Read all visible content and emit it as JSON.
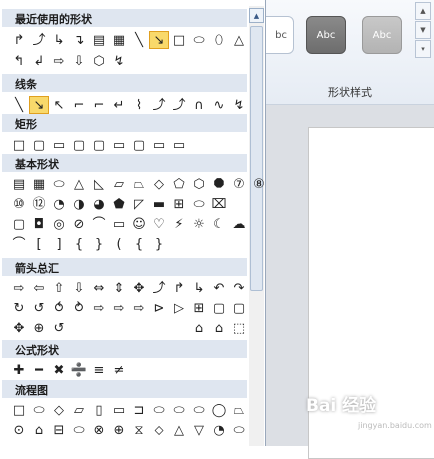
{
  "ribbon": {
    "style_samples": [
      "bc",
      "Abc",
      "Abc"
    ],
    "group_label": "形状样式"
  },
  "watermark": {
    "text": "Bai 经验",
    "sub": "jingyan.baidu.com"
  },
  "panel": {
    "categories": [
      {
        "label": "最近使用的形状",
        "rows": [
          [
            "↱",
            "⤴",
            "↳",
            "↴",
            "▤",
            "▦",
            "╲",
            "↘",
            "□",
            "⬭",
            "⬯",
            "△"
          ],
          [
            "↰",
            "↲",
            "⇨",
            "⇩",
            "⬡",
            "↯"
          ]
        ]
      },
      {
        "label": "线条",
        "rows": [
          [
            "╲",
            "↘",
            "↖",
            "⌐",
            "⌐",
            "↵",
            "⌇",
            "⤴",
            "⤴",
            "∩",
            "∿",
            "↯"
          ]
        ]
      },
      {
        "label": "矩形",
        "rows": [
          [
            "□",
            "▢",
            "▭",
            "▢",
            "▢",
            "▭",
            "▢",
            "▭",
            "▭"
          ]
        ]
      },
      {
        "label": "基本形状",
        "rows": [
          [
            "▤",
            "▦",
            "⬭",
            "△",
            "◺",
            "▱",
            "⏢",
            "◇",
            "⬠",
            "⬡",
            "⯃",
            "⑦",
            "⑧"
          ],
          [
            "⑩",
            "⑫",
            "◔",
            "◑",
            "◕",
            "⬟",
            "◸",
            "▬",
            "⊞",
            "⬭",
            "⌧"
          ],
          [
            "▢",
            "◘",
            "◎",
            "⊘",
            "⌒",
            "▭",
            "☺",
            "♡",
            "⚡",
            "☼",
            "☾",
            "☁"
          ],
          [
            "⌒",
            "[",
            "]",
            "{",
            "}",
            "(",
            "{",
            "}"
          ]
        ]
      },
      {
        "label": "箭头总汇",
        "rows": [
          [
            "⇨",
            "⇦",
            "⇧",
            "⇩",
            "⇔",
            "⇕",
            "✥",
            "⤴",
            "↱",
            "↳",
            "↶",
            "↷"
          ],
          [
            "↻",
            "↺",
            "⥀",
            "⥁",
            "⇨",
            "⇨",
            "⇨",
            "⊳",
            "▷",
            "⊞",
            "▢",
            "▢"
          ],
          [
            "⌂",
            "⌂",
            "⬚"
          ],
          [
            "✥",
            "⊕",
            "↺"
          ]
        ]
      },
      {
        "label": "公式形状",
        "rows": [
          [
            "✚",
            "━",
            "✖",
            "➗",
            "≡",
            "≠"
          ]
        ]
      },
      {
        "label": "流程图",
        "rows": [
          [
            "□",
            "⬭",
            "◇",
            "▱",
            "▯",
            "▭",
            "⊐",
            "⬭",
            "⬭",
            "⬭",
            "◯",
            "⏢"
          ],
          [
            "⊙",
            "⌂",
            "⊟",
            "⬭",
            "⊗",
            "⊕",
            "⧖",
            "⬦",
            "△",
            "▽",
            "◔",
            "⬭"
          ]
        ]
      }
    ]
  }
}
